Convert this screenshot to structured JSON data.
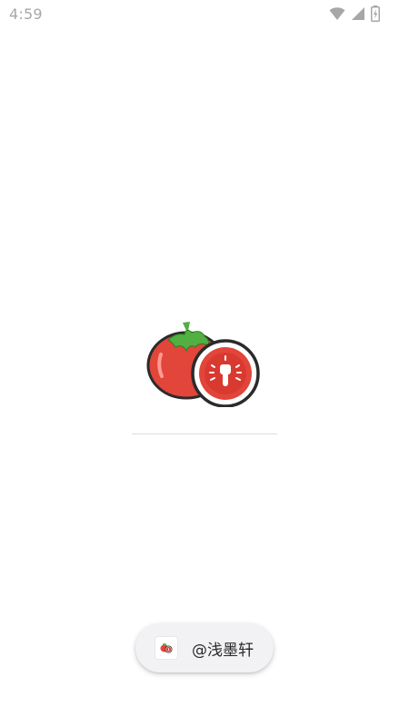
{
  "status_bar": {
    "time": "4:59",
    "icons": [
      "wifi-icon",
      "cellular-signal-icon",
      "battery-charging-icon"
    ]
  },
  "splash": {
    "logo_icon": "tomato-logo-icon"
  },
  "toast": {
    "icon": "tomato-app-icon",
    "text": "@浅墨轩"
  },
  "colors": {
    "tomato_red": "#e2453a",
    "leaf_green": "#52b043",
    "status_gray": "#a7a7a7",
    "toast_bg": "#f2f2f4"
  }
}
